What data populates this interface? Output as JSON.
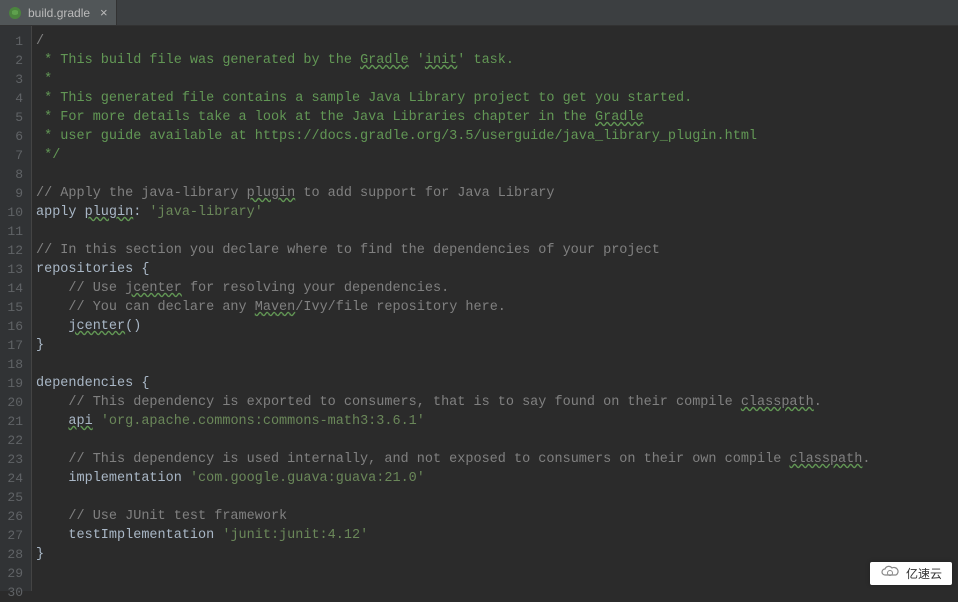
{
  "tab": {
    "filename": "build.gradle",
    "close": "×"
  },
  "gutter": {
    "start": 1,
    "end": 30
  },
  "code": {
    "lines": [
      {
        "n": 1,
        "segments": [
          {
            "t": "/",
            "c": "comment"
          }
        ]
      },
      {
        "n": 2,
        "segments": [
          {
            "t": " * This build file was generated by the ",
            "c": "doc-comment"
          },
          {
            "t": "Gradle",
            "c": "doc-comment typo"
          },
          {
            "t": " '",
            "c": "doc-comment"
          },
          {
            "t": "init",
            "c": "doc-comment typo"
          },
          {
            "t": "' task.",
            "c": "doc-comment"
          }
        ]
      },
      {
        "n": 3,
        "segments": [
          {
            "t": " *",
            "c": "doc-comment"
          }
        ]
      },
      {
        "n": 4,
        "segments": [
          {
            "t": " * This generated file contains a sample Java Library project to get you started.",
            "c": "doc-comment"
          }
        ]
      },
      {
        "n": 5,
        "segments": [
          {
            "t": " * For more details take a look at the Java Libraries chapter in the ",
            "c": "doc-comment"
          },
          {
            "t": "Gradle",
            "c": "doc-comment typo"
          }
        ]
      },
      {
        "n": 6,
        "segments": [
          {
            "t": " * user guide available at https://docs.gradle.org/3.5/userguide/java_library_plugin.html",
            "c": "doc-comment"
          }
        ]
      },
      {
        "n": 7,
        "segments": [
          {
            "t": " */",
            "c": "doc-comment"
          }
        ]
      },
      {
        "n": 8,
        "segments": [
          {
            "t": "",
            "c": ""
          }
        ]
      },
      {
        "n": 9,
        "segments": [
          {
            "t": "// Apply the java-library ",
            "c": "comment"
          },
          {
            "t": "plugin",
            "c": "comment typo"
          },
          {
            "t": " to add support for Java Library",
            "c": "comment"
          }
        ]
      },
      {
        "n": 10,
        "segments": [
          {
            "t": "apply ",
            "c": ""
          },
          {
            "t": "plugin",
            "c": "typo"
          },
          {
            "t": ": ",
            "c": ""
          },
          {
            "t": "'java-library'",
            "c": "string"
          }
        ]
      },
      {
        "n": 11,
        "segments": [
          {
            "t": "",
            "c": ""
          }
        ]
      },
      {
        "n": 12,
        "segments": [
          {
            "t": "// In this section you declare where to find the dependencies of your project",
            "c": "comment"
          }
        ]
      },
      {
        "n": 13,
        "segments": [
          {
            "t": "repositories {",
            "c": ""
          }
        ]
      },
      {
        "n": 14,
        "segments": [
          {
            "t": "    ",
            "c": ""
          },
          {
            "t": "// Use ",
            "c": "comment"
          },
          {
            "t": "jcenter",
            "c": "comment typo"
          },
          {
            "t": " for resolving your dependencies.",
            "c": "comment"
          }
        ]
      },
      {
        "n": 15,
        "segments": [
          {
            "t": "    ",
            "c": ""
          },
          {
            "t": "// You can declare any ",
            "c": "comment"
          },
          {
            "t": "Maven",
            "c": "comment typo"
          },
          {
            "t": "/Ivy/file repository here.",
            "c": "comment"
          }
        ]
      },
      {
        "n": 16,
        "segments": [
          {
            "t": "    ",
            "c": ""
          },
          {
            "t": "jcenter",
            "c": "typo"
          },
          {
            "t": "()",
            "c": ""
          }
        ]
      },
      {
        "n": 17,
        "segments": [
          {
            "t": "}",
            "c": ""
          }
        ]
      },
      {
        "n": 18,
        "segments": [
          {
            "t": "",
            "c": ""
          }
        ]
      },
      {
        "n": 19,
        "segments": [
          {
            "t": "dependencies {",
            "c": ""
          }
        ]
      },
      {
        "n": 20,
        "segments": [
          {
            "t": "    ",
            "c": ""
          },
          {
            "t": "// This dependency is exported to consumers, that is to say found on their compile ",
            "c": "comment"
          },
          {
            "t": "classpath",
            "c": "comment typo"
          },
          {
            "t": ".",
            "c": "comment"
          }
        ]
      },
      {
        "n": 21,
        "segments": [
          {
            "t": "    ",
            "c": ""
          },
          {
            "t": "api",
            "c": "typo"
          },
          {
            "t": " ",
            "c": ""
          },
          {
            "t": "'org.apache.commons:commons-math3:3.6.1'",
            "c": "string"
          }
        ]
      },
      {
        "n": 22,
        "segments": [
          {
            "t": "",
            "c": ""
          }
        ]
      },
      {
        "n": 23,
        "segments": [
          {
            "t": "    ",
            "c": ""
          },
          {
            "t": "// This dependency is used internally, and not exposed to consumers on their own compile ",
            "c": "comment"
          },
          {
            "t": "classpath",
            "c": "comment typo"
          },
          {
            "t": ".",
            "c": "comment"
          }
        ]
      },
      {
        "n": 24,
        "segments": [
          {
            "t": "    implementation ",
            "c": ""
          },
          {
            "t": "'com.google.guava:guava:21.0'",
            "c": "string"
          }
        ]
      },
      {
        "n": 25,
        "segments": [
          {
            "t": "",
            "c": ""
          }
        ]
      },
      {
        "n": 26,
        "segments": [
          {
            "t": "    ",
            "c": ""
          },
          {
            "t": "// Use JUnit test framework",
            "c": "comment"
          }
        ]
      },
      {
        "n": 27,
        "segments": [
          {
            "t": "    testImplementation ",
            "c": ""
          },
          {
            "t": "'junit:junit:4.12'",
            "c": "string"
          }
        ]
      },
      {
        "n": 28,
        "segments": [
          {
            "t": "}",
            "c": ""
          }
        ]
      },
      {
        "n": 29,
        "segments": [
          {
            "t": "",
            "c": ""
          }
        ]
      },
      {
        "n": 30,
        "segments": [
          {
            "t": "",
            "c": ""
          }
        ]
      }
    ]
  },
  "watermark": {
    "text": "亿速云"
  }
}
